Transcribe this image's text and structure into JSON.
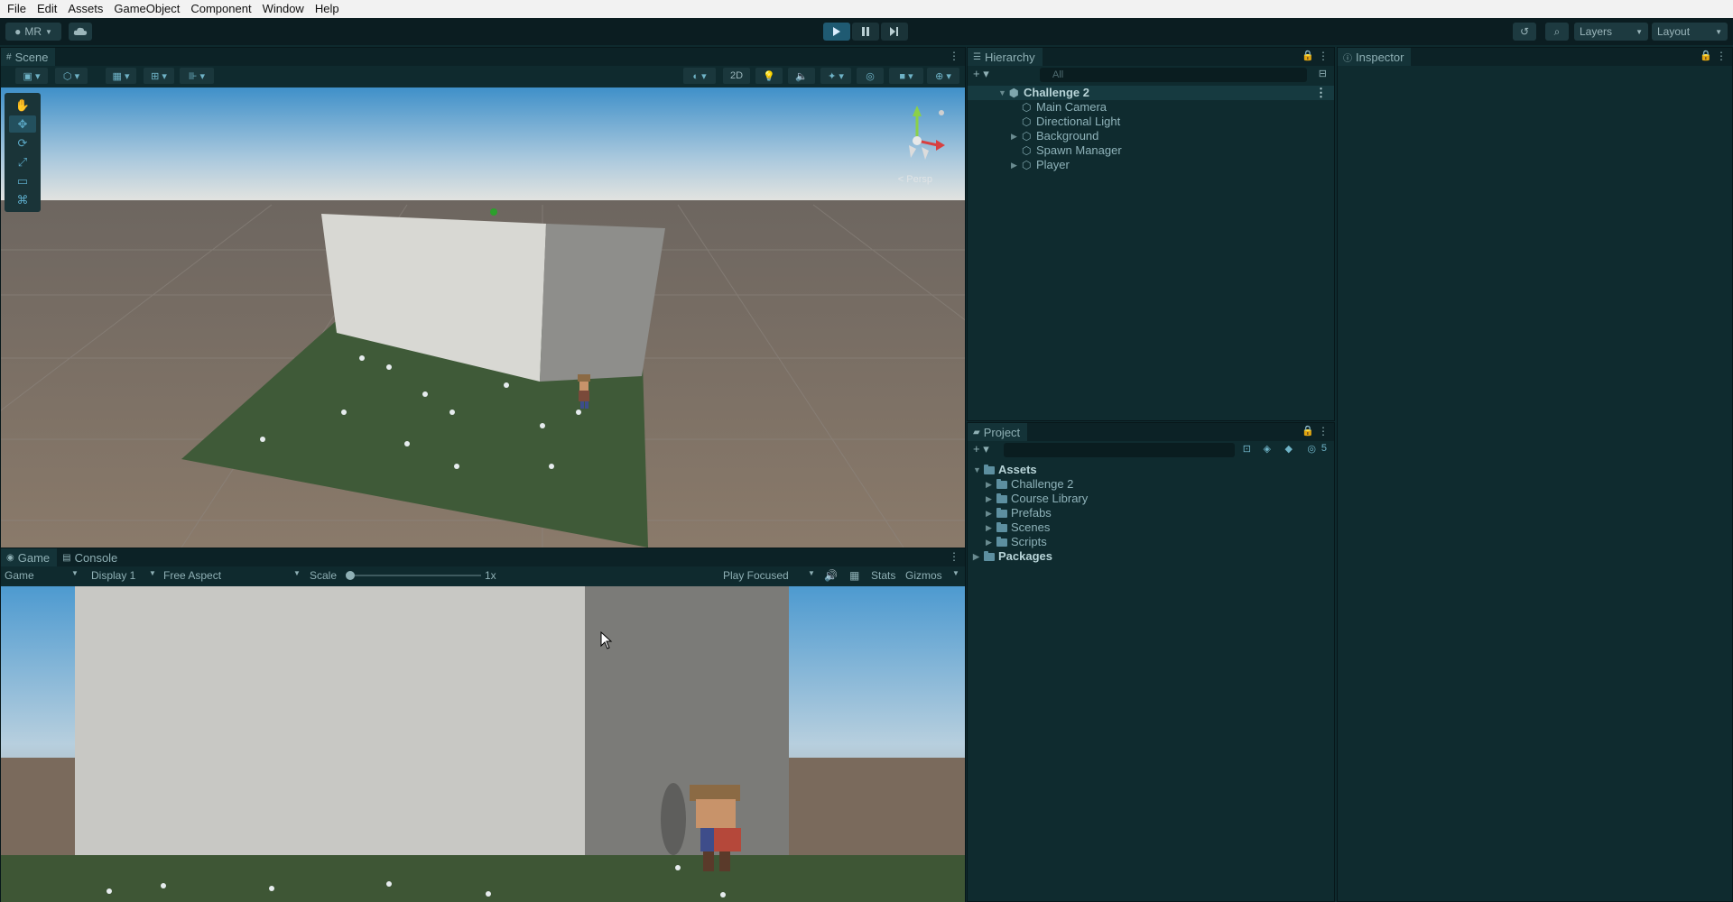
{
  "menubar": {
    "items": [
      "File",
      "Edit",
      "Assets",
      "GameObject",
      "Component",
      "Window",
      "Help"
    ]
  },
  "toolbar": {
    "account_label": "MR",
    "layers_label": "Layers",
    "layout_label": "Layout",
    "play_icons": [
      "play-icon",
      "pause-icon",
      "step-icon"
    ]
  },
  "scene": {
    "tab_label": "Scene",
    "mode_2d_label": "2D",
    "persp_label": "< Persp"
  },
  "game": {
    "tabs": [
      "Game",
      "Console"
    ],
    "view_mode": "Game",
    "display": "Display 1",
    "aspect": "Free Aspect",
    "scale_label": "Scale",
    "scale_value": "1x",
    "play_focused": "Play Focused",
    "stats_label": "Stats",
    "gizmos_label": "Gizmos"
  },
  "hierarchy": {
    "tab_label": "Hierarchy",
    "search_placeholder": "All",
    "scene_name": "Challenge 2",
    "objects": [
      {
        "name": "Main Camera",
        "expandable": false
      },
      {
        "name": "Directional Light",
        "expandable": false
      },
      {
        "name": "Background",
        "expandable": true
      },
      {
        "name": "Spawn Manager",
        "expandable": false
      },
      {
        "name": "Player",
        "expandable": true
      }
    ]
  },
  "project": {
    "tab_label": "Project",
    "hidden_count": "5",
    "root": "Assets",
    "folders": [
      "Challenge 2",
      "Course Library",
      "Prefabs",
      "Scenes",
      "Scripts"
    ],
    "packages": "Packages"
  },
  "inspector": {
    "tab_label": "Inspector"
  }
}
